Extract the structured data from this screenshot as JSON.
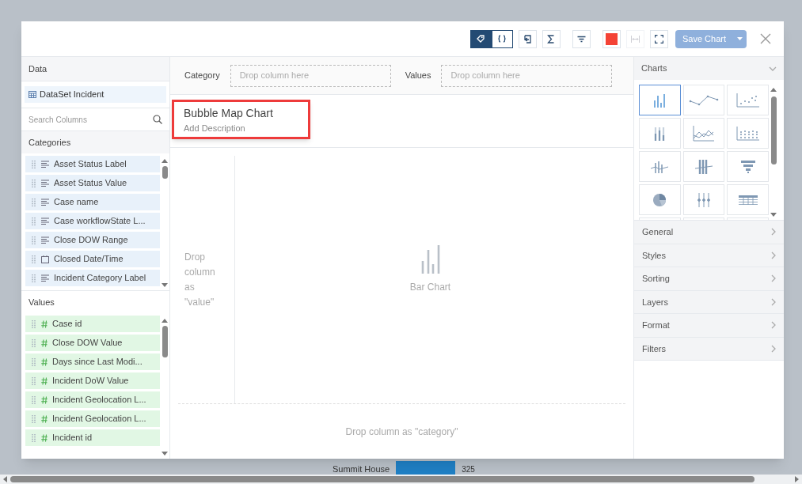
{
  "background": {
    "row_label": "Summit House",
    "row_value": "325"
  },
  "toolbar": {
    "mode_buttons": [
      {
        "kind": "tag",
        "selected": true
      },
      {
        "kind": "braces",
        "selected": false
      }
    ],
    "tools": [
      {
        "kind": "legend",
        "disabled": false
      },
      {
        "kind": "sigma",
        "disabled": false
      },
      {
        "kind": "filter",
        "disabled": false
      }
    ],
    "color": "#f44336",
    "width_disabled": true,
    "save_button": {
      "label": "Save Chart",
      "disabled": true
    }
  },
  "data_panel": {
    "title": "Data",
    "dataset": "DataSet Incident",
    "search": {
      "placeholder": "Search Columns"
    },
    "categories_title": "Categories",
    "categories": [
      {
        "label": "Asset Status Label",
        "kind": "text"
      },
      {
        "label": "Asset Status Value",
        "kind": "text"
      },
      {
        "label": "Case name",
        "kind": "text"
      },
      {
        "label": "Case workflowState L...",
        "kind": "text"
      },
      {
        "label": "Close DOW Range",
        "kind": "text"
      },
      {
        "label": "Closed Date/Time",
        "kind": "date"
      },
      {
        "label": "Incident Category Label",
        "kind": "text"
      }
    ],
    "values_title": "Values",
    "values": [
      {
        "label": "Case id"
      },
      {
        "label": "Close DOW Value"
      },
      {
        "label": "Days since Last Modi..."
      },
      {
        "label": "Incident DoW Value"
      },
      {
        "label": "Incident Geolocation L..."
      },
      {
        "label": "Incident Geolocation L..."
      },
      {
        "label": "Incident id"
      }
    ]
  },
  "drop_bar": {
    "category_label": "Category",
    "category_placeholder": "Drop column here",
    "values_label": "Values",
    "values_placeholder": "Drop column here"
  },
  "chart_header": {
    "title": "Bubble Map Chart",
    "description": "Add Description"
  },
  "canvas": {
    "value_drop": "Drop column as \"value\"",
    "placeholder_label": "Bar Chart",
    "category_drop": "Drop column as \"category\""
  },
  "charts_panel": {
    "title": "Charts",
    "types": [
      {
        "kind": "bar",
        "selected": true
      },
      {
        "kind": "line",
        "selected": false
      },
      {
        "kind": "scatter",
        "selected": false
      },
      {
        "kind": "stacked",
        "selected": false
      },
      {
        "kind": "area",
        "selected": false
      },
      {
        "kind": "dots",
        "selected": false
      },
      {
        "kind": "combo",
        "selected": false
      },
      {
        "kind": "combo-stacked",
        "selected": false
      },
      {
        "kind": "funnel",
        "selected": false
      },
      {
        "kind": "pie",
        "selected": false
      },
      {
        "kind": "range",
        "selected": false
      },
      {
        "kind": "table",
        "selected": false
      }
    ],
    "sections": [
      "General",
      "Styles",
      "Sorting",
      "Layers",
      "Format",
      "Filters"
    ]
  }
}
